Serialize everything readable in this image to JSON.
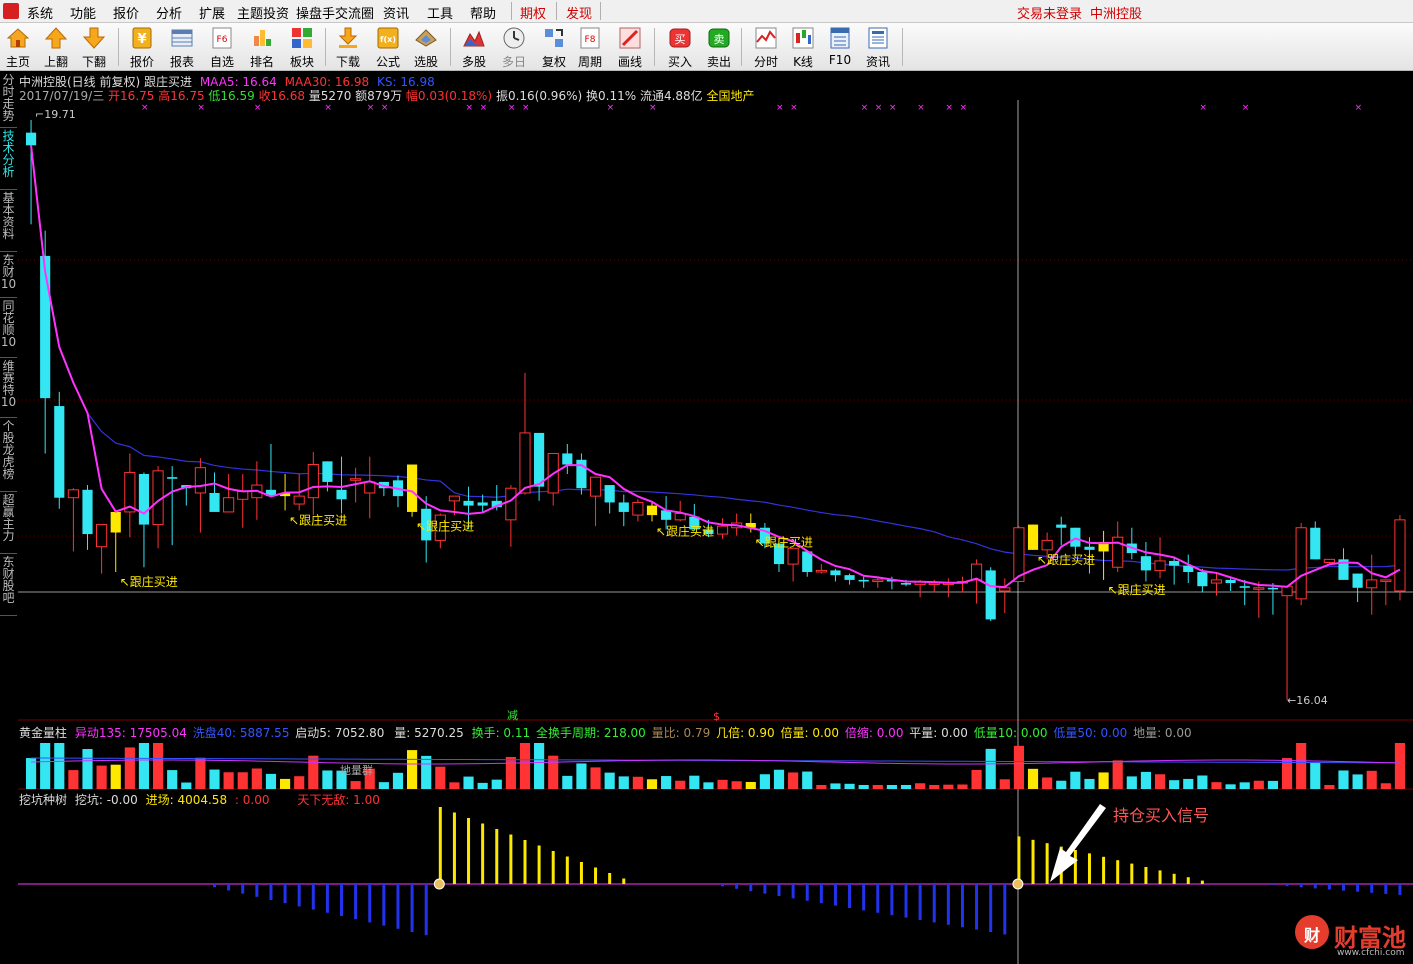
{
  "menubar": {
    "items": [
      "系统",
      "功能",
      "报价",
      "分析",
      "扩展",
      "主题投资",
      "操盘手交流圈",
      "资讯",
      "工具",
      "帮助"
    ],
    "highlight_items": [
      "期权",
      "发现"
    ],
    "right_links": [
      "交易未登录",
      "中洲控股"
    ]
  },
  "toolbar": {
    "buttons": [
      {
        "label": "主页",
        "icon": "home-icon"
      },
      {
        "label": "上翻",
        "icon": "arrow-up-icon"
      },
      {
        "label": "下翻",
        "icon": "arrow-down-icon"
      },
      {
        "label": "报价",
        "icon": "quote-icon"
      },
      {
        "label": "报表",
        "icon": "report-icon"
      },
      {
        "label": "自选",
        "icon": "f6-watchlist-icon"
      },
      {
        "label": "排名",
        "icon": "ranking-icon"
      },
      {
        "label": "板块",
        "icon": "sector-icon"
      },
      {
        "label": "下载",
        "icon": "download-icon"
      },
      {
        "label": "公式",
        "icon": "formula-icon"
      },
      {
        "label": "选股",
        "icon": "stock-select-icon"
      },
      {
        "label": "多股",
        "icon": "multi-stock-icon"
      },
      {
        "label": "多日",
        "icon": "multi-day-icon"
      },
      {
        "label": "复权",
        "icon": "adjust-icon"
      },
      {
        "label": "周期",
        "icon": "f8-period-icon"
      },
      {
        "label": "画线",
        "icon": "draw-line-icon"
      },
      {
        "label": "买入",
        "icon": "buy-icon"
      },
      {
        "label": "卖出",
        "icon": "sell-icon"
      },
      {
        "label": "分时",
        "icon": "intraday-icon"
      },
      {
        "label": "K线",
        "icon": "kline-icon"
      },
      {
        "label": "F10",
        "icon": "f10-icon"
      },
      {
        "label": "资讯",
        "icon": "news-icon"
      }
    ],
    "buy_glyph": "买",
    "sell_glyph": "卖",
    "f6_glyph": "F6",
    "f8_glyph": "F8",
    "formula_glyph": "f(x)"
  },
  "side_tabs": [
    "分时走势",
    "技术分析",
    "基本资料",
    "东财10",
    "同花顺10",
    "维赛特10",
    "个股龙虎榜",
    "超赢主力",
    "东财股吧"
  ],
  "header": {
    "title": "中洲控股(日线 前复权) 跟庄买进",
    "maa5_label": "MAA5: 16.64",
    "maa30_label": "MAA30: 16.98",
    "ks_label": "KS: 16.98",
    "date": "2017/07/19/三",
    "open_label": "开16.75",
    "high_label": "高16.75",
    "low_label": "低16.59",
    "close_label": "收16.68",
    "volume_label": "量5270",
    "amount_label": "额879万",
    "change_label": "幅0.03(0.18%)",
    "amplitude_label": "振0.16(0.96%)",
    "turnover_label": "换0.11%",
    "float_label": "流通4.88亿",
    "sector_label": "全国地产"
  },
  "colors": {
    "up": "#ff3333",
    "down": "#33e6f2",
    "signal": "#ffe800",
    "maa5": "#ff33ff",
    "maa30": "#3333dd",
    "axis": "#cccccc"
  },
  "chart_data": {
    "type": "candlestick",
    "price_high_label": "19.71",
    "price_low_label": "16.04",
    "signal_label": "跟庄买进",
    "candles": [
      {
        "o": 19.63,
        "h": 19.71,
        "l": 19.05,
        "c": 19.55
      },
      {
        "o": 18.85,
        "h": 19.01,
        "l": 17.6,
        "c": 17.95
      },
      {
        "o": 17.9,
        "h": 17.99,
        "l": 17.25,
        "c": 17.32
      },
      {
        "o": 17.32,
        "h": 17.38,
        "l": 16.98,
        "c": 17.37
      },
      {
        "o": 17.37,
        "h": 17.4,
        "l": 16.99,
        "c": 17.09
      },
      {
        "o": 17.01,
        "h": 17.14,
        "l": 16.84,
        "c": 17.15
      },
      {
        "o": 17.1,
        "h": 17.2,
        "l": 16.85,
        "c": 17.23
      },
      {
        "o": 17.23,
        "h": 17.6,
        "l": 17.07,
        "c": 17.48
      },
      {
        "o": 17.47,
        "h": 17.48,
        "l": 16.88,
        "c": 17.15
      },
      {
        "o": 17.15,
        "h": 17.52,
        "l": 17.0,
        "c": 17.49
      },
      {
        "o": 17.45,
        "h": 17.52,
        "l": 17.02,
        "c": 17.44
      },
      {
        "o": 17.4,
        "h": 17.4,
        "l": 17.27,
        "c": 17.38
      },
      {
        "o": 17.35,
        "h": 17.57,
        "l": 17.1,
        "c": 17.51
      },
      {
        "o": 17.35,
        "h": 17.48,
        "l": 17.24,
        "c": 17.23
      },
      {
        "o": 17.23,
        "h": 17.47,
        "l": 17.23,
        "c": 17.32
      },
      {
        "o": 17.31,
        "h": 17.47,
        "l": 17.13,
        "c": 17.36
      },
      {
        "o": 17.32,
        "h": 17.55,
        "l": 17.18,
        "c": 17.4
      },
      {
        "o": 17.37,
        "h": 17.66,
        "l": 17.34,
        "c": 17.33
      },
      {
        "o": 17.33,
        "h": 17.47,
        "l": 17.24,
        "c": 17.35
      },
      {
        "o": 17.28,
        "h": 17.47,
        "l": 17.24,
        "c": 17.33
      },
      {
        "o": 17.32,
        "h": 17.61,
        "l": 17.21,
        "c": 17.53
      },
      {
        "o": 17.55,
        "h": 17.55,
        "l": 17.36,
        "c": 17.42
      },
      {
        "o": 17.37,
        "h": 17.58,
        "l": 17.22,
        "c": 17.31
      },
      {
        "o": 17.44,
        "h": 17.51,
        "l": 17.29,
        "c": 17.44
      },
      {
        "o": 17.35,
        "h": 17.58,
        "l": 17.19,
        "c": 17.42
      },
      {
        "o": 17.42,
        "h": 17.42,
        "l": 17.33,
        "c": 17.38
      },
      {
        "o": 17.43,
        "h": 17.46,
        "l": 17.26,
        "c": 17.33
      },
      {
        "o": 17.53,
        "h": 17.53,
        "l": 17.2,
        "c": 17.23
      },
      {
        "o": 17.25,
        "h": 17.33,
        "l": 16.91,
        "c": 17.05
      },
      {
        "o": 17.05,
        "h": 17.22,
        "l": 17.0,
        "c": 17.21
      },
      {
        "o": 17.3,
        "h": 17.32,
        "l": 17.21,
        "c": 17.33
      },
      {
        "o": 17.3,
        "h": 17.39,
        "l": 17.12,
        "c": 17.27
      },
      {
        "o": 17.29,
        "h": 17.34,
        "l": 17.22,
        "c": 17.27
      },
      {
        "o": 17.3,
        "h": 17.4,
        "l": 17.24,
        "c": 17.26
      },
      {
        "o": 17.18,
        "h": 17.4,
        "l": 17.01,
        "c": 17.38
      },
      {
        "o": 17.35,
        "h": 18.11,
        "l": 17.34,
        "c": 17.73
      },
      {
        "o": 17.73,
        "h": 17.73,
        "l": 17.3,
        "c": 17.39
      },
      {
        "o": 17.35,
        "h": 17.57,
        "l": 17.27,
        "c": 17.6
      },
      {
        "o": 17.6,
        "h": 17.66,
        "l": 17.47,
        "c": 17.53
      },
      {
        "o": 17.56,
        "h": 17.6,
        "l": 17.34,
        "c": 17.38
      },
      {
        "o": 17.33,
        "h": 17.44,
        "l": 17.14,
        "c": 17.45
      },
      {
        "o": 17.4,
        "h": 17.4,
        "l": 17.22,
        "c": 17.29
      },
      {
        "o": 17.29,
        "h": 17.34,
        "l": 17.14,
        "c": 17.23
      },
      {
        "o": 17.21,
        "h": 17.31,
        "l": 17.17,
        "c": 17.29
      },
      {
        "o": 17.27,
        "h": 17.29,
        "l": 17.17,
        "c": 17.21
      },
      {
        "o": 17.24,
        "h": 17.33,
        "l": 17.12,
        "c": 17.18
      },
      {
        "o": 17.18,
        "h": 17.3,
        "l": 17.17,
        "c": 17.22
      },
      {
        "o": 17.2,
        "h": 17.28,
        "l": 17.11,
        "c": 17.12
      },
      {
        "o": 17.12,
        "h": 17.18,
        "l": 17.07,
        "c": 17.09
      },
      {
        "o": 17.09,
        "h": 17.19,
        "l": 17.06,
        "c": 17.14
      },
      {
        "o": 17.13,
        "h": 17.22,
        "l": 17.08,
        "c": 17.16
      },
      {
        "o": 17.16,
        "h": 17.22,
        "l": 17.1,
        "c": 17.13
      },
      {
        "o": 17.13,
        "h": 17.16,
        "l": 17.0,
        "c": 17.03
      },
      {
        "o": 17.03,
        "h": 17.06,
        "l": 16.85,
        "c": 16.9
      },
      {
        "o": 16.9,
        "h": 17.0,
        "l": 16.79,
        "c": 17.0
      },
      {
        "o": 16.98,
        "h": 16.98,
        "l": 16.82,
        "c": 16.85
      },
      {
        "o": 16.85,
        "h": 16.9,
        "l": 16.84,
        "c": 16.86
      },
      {
        "o": 16.86,
        "h": 16.87,
        "l": 16.79,
        "c": 16.83
      },
      {
        "o": 16.83,
        "h": 16.84,
        "l": 16.77,
        "c": 16.8
      },
      {
        "o": 16.8,
        "h": 16.82,
        "l": 16.75,
        "c": 16.79
      },
      {
        "o": 16.79,
        "h": 16.81,
        "l": 16.75,
        "c": 16.8
      },
      {
        "o": 16.8,
        "h": 16.82,
        "l": 16.74,
        "c": 16.79
      },
      {
        "o": 16.78,
        "h": 16.8,
        "l": 16.76,
        "c": 16.77
      },
      {
        "o": 16.77,
        "h": 16.8,
        "l": 16.69,
        "c": 16.79
      },
      {
        "o": 16.78,
        "h": 16.8,
        "l": 16.72,
        "c": 16.78
      },
      {
        "o": 16.78,
        "h": 16.81,
        "l": 16.69,
        "c": 16.78
      },
      {
        "o": 16.78,
        "h": 16.82,
        "l": 16.72,
        "c": 16.79
      },
      {
        "o": 16.8,
        "h": 16.93,
        "l": 16.65,
        "c": 16.9
      },
      {
        "o": 16.86,
        "h": 16.88,
        "l": 16.54,
        "c": 16.55
      },
      {
        "o": 16.73,
        "h": 16.81,
        "l": 16.59,
        "c": 16.75
      },
      {
        "o": 16.79,
        "h": 17.14,
        "l": 16.79,
        "c": 17.13
      },
      {
        "o": 17.15,
        "h": 17.15,
        "l": 16.99,
        "c": 16.99
      },
      {
        "o": 16.99,
        "h": 17.1,
        "l": 16.93,
        "c": 17.05
      },
      {
        "o": 17.15,
        "h": 17.2,
        "l": 17.02,
        "c": 17.13
      },
      {
        "o": 17.13,
        "h": 17.13,
        "l": 16.95,
        "c": 17.01
      },
      {
        "o": 17.01,
        "h": 17.07,
        "l": 16.84,
        "c": 16.99
      },
      {
        "o": 17.04,
        "h": 17.11,
        "l": 16.8,
        "c": 16.98
      },
      {
        "o": 16.88,
        "h": 17.17,
        "l": 16.85,
        "c": 17.07
      },
      {
        "o": 17.03,
        "h": 17.13,
        "l": 16.93,
        "c": 16.97
      },
      {
        "o": 16.95,
        "h": 17.04,
        "l": 16.79,
        "c": 16.86
      },
      {
        "o": 16.86,
        "h": 17.07,
        "l": 16.81,
        "c": 16.92
      },
      {
        "o": 16.92,
        "h": 16.94,
        "l": 16.77,
        "c": 16.89
      },
      {
        "o": 16.89,
        "h": 16.96,
        "l": 16.78,
        "c": 16.85
      },
      {
        "o": 16.85,
        "h": 16.87,
        "l": 16.72,
        "c": 16.76
      },
      {
        "o": 16.78,
        "h": 16.84,
        "l": 16.7,
        "c": 16.8
      },
      {
        "o": 16.8,
        "h": 16.81,
        "l": 16.73,
        "c": 16.78
      },
      {
        "o": 16.76,
        "h": 16.8,
        "l": 16.64,
        "c": 16.75
      },
      {
        "o": 16.75,
        "h": 16.79,
        "l": 16.56,
        "c": 16.75
      },
      {
        "o": 16.75,
        "h": 16.78,
        "l": 16.58,
        "c": 16.74
      },
      {
        "o": 16.7,
        "h": 16.75,
        "l": 16.04,
        "c": 16.76
      },
      {
        "o": 16.68,
        "h": 17.16,
        "l": 16.64,
        "c": 17.13
      },
      {
        "o": 17.13,
        "h": 17.17,
        "l": 16.93,
        "c": 16.93
      },
      {
        "o": 16.91,
        "h": 16.93,
        "l": 16.89,
        "c": 16.93
      },
      {
        "o": 16.93,
        "h": 17.0,
        "l": 16.81,
        "c": 16.8
      },
      {
        "o": 16.84,
        "h": 16.84,
        "l": 16.66,
        "c": 16.75
      },
      {
        "o": 16.75,
        "h": 16.96,
        "l": 16.58,
        "c": 16.8
      },
      {
        "o": 16.8,
        "h": 16.8,
        "l": 16.64,
        "c": 16.8
      },
      {
        "o": 16.73,
        "h": 17.21,
        "l": 16.67,
        "c": 17.18
      }
    ],
    "signals_at": [
      6,
      18,
      27,
      44,
      51,
      71,
      76
    ],
    "cross_marks_at": [
      8,
      12,
      16,
      21,
      24,
      25,
      31,
      32,
      34,
      35,
      41,
      44,
      53,
      54,
      59,
      60,
      61,
      63,
      65,
      66,
      83,
      86,
      94
    ]
  },
  "volume_panel": {
    "name": "黄金量柱",
    "yidong": "异动135: 17505.04",
    "xipan": "洗盘40: 5887.55",
    "qidong": "启动5: 7052.80",
    "liang": "量: 5270.25",
    "huanshou": "换手: 0.11",
    "quanhuan": "全换手周期: 218.00",
    "liangbi": "量比: 0.79",
    "jibei": "几倍: 0.90",
    "beiliang": "倍量: 0.00",
    "beisuo": "倍缩: 0.00",
    "pingliang": "平量: 0.00",
    "diliang10": "低量10: 0.00",
    "diliang50": "低量50: 0.00",
    "diliang": "地量: 0.00",
    "diliang_group": "地量群",
    "marker_jian": "减",
    "marker_s": "$"
  },
  "indicator_panel": {
    "name": "挖坑种树",
    "wakeng": "挖坑: -0.00",
    "jinchang": "进场: 4004.58",
    "empty_val": ": 0.00",
    "tianxia": "天下无敌: 1.00",
    "annotation": "持仓买入信号"
  },
  "watermark": {
    "brand": "财富池",
    "url": "www.cfchi.com",
    "logo_glyph": "财"
  }
}
